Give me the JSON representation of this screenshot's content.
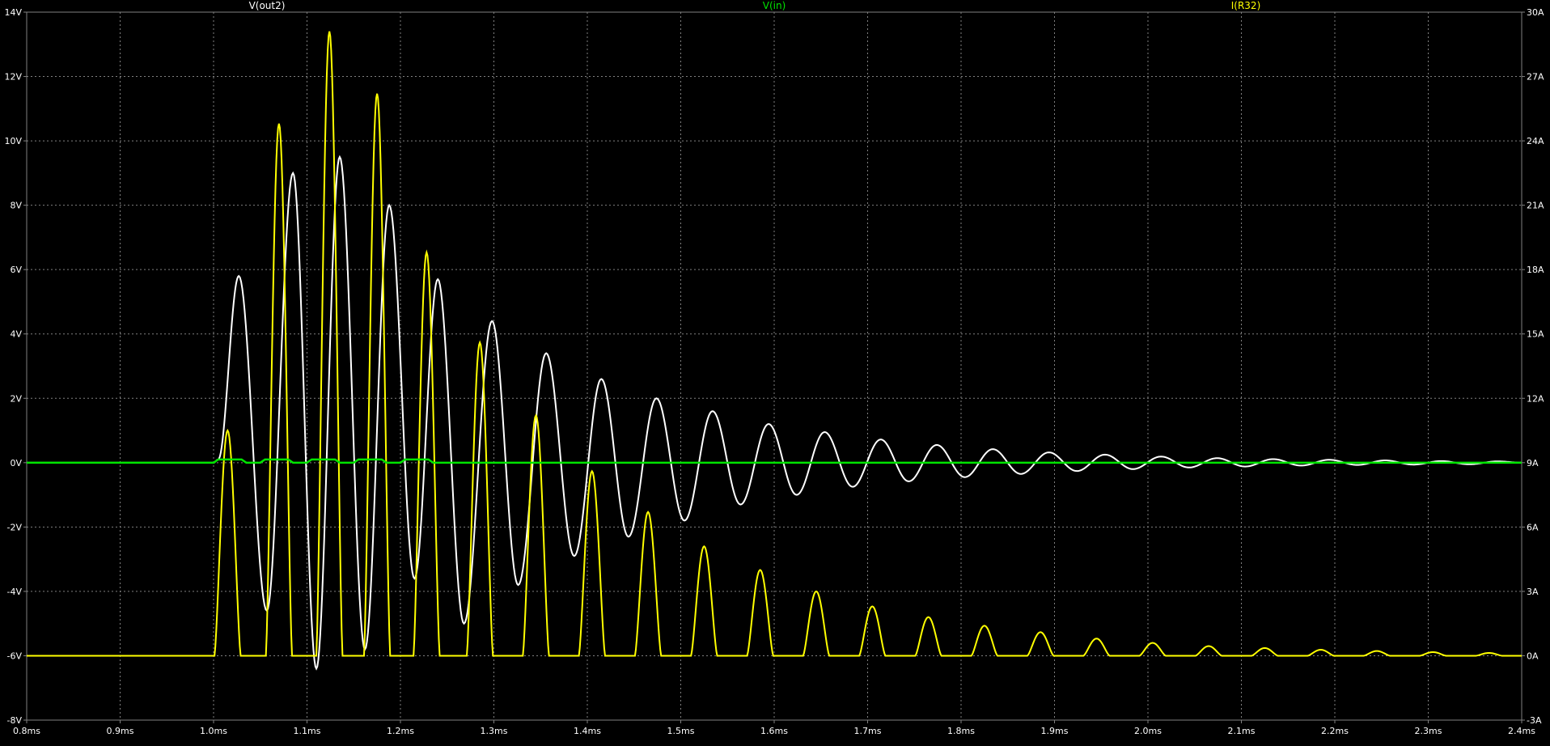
{
  "chart_data": {
    "type": "line",
    "title": "",
    "x_axis": {
      "range": [
        0.8,
        2.4
      ],
      "ticks": [
        0.8,
        0.9,
        1.0,
        1.1,
        1.2,
        1.3,
        1.4,
        1.5,
        1.6,
        1.7,
        1.8,
        1.9,
        2.0,
        2.1,
        2.2,
        2.3,
        2.4
      ],
      "tick_labels": [
        "0.8ms",
        "0.9ms",
        "1.0ms",
        "1.1ms",
        "1.2ms",
        "1.3ms",
        "1.4ms",
        "1.5ms",
        "1.6ms",
        "1.7ms",
        "1.8ms",
        "1.9ms",
        "2.0ms",
        "2.1ms",
        "2.2ms",
        "2.3ms",
        "2.4ms"
      ]
    },
    "y_left": {
      "range": [
        -8,
        14
      ],
      "ticks": [
        -8,
        -6,
        -4,
        -2,
        0,
        2,
        4,
        6,
        8,
        10,
        12,
        14
      ],
      "tick_labels": [
        "-8V",
        "-6V",
        "-4V",
        "-2V",
        "0V",
        "2V",
        "4V",
        "6V",
        "8V",
        "10V",
        "12V",
        "14V"
      ]
    },
    "y_right": {
      "range": [
        -3,
        30
      ],
      "ticks": [
        -3,
        0,
        3,
        6,
        9,
        12,
        15,
        18,
        21,
        24,
        27,
        30
      ],
      "tick_labels": [
        "-3A",
        "0A",
        "3A",
        "6A",
        "9A",
        "12A",
        "15A",
        "18A",
        "21A",
        "24A",
        "27A",
        "30A"
      ]
    },
    "grid": true,
    "legend": "top",
    "series": [
      {
        "name": "V(out2)",
        "axis": "left",
        "color": "#ffffff",
        "x": [
          0.8,
          1.0,
          1.005,
          1.027,
          1.057,
          1.085,
          1.11,
          1.135,
          1.162,
          1.188,
          1.215,
          1.24,
          1.268,
          1.298,
          1.326,
          1.356,
          1.386,
          1.415,
          1.444,
          1.474,
          1.504,
          1.534,
          1.564,
          1.594,
          1.624,
          1.654,
          1.684,
          1.714,
          1.744,
          1.774,
          1.804,
          1.834,
          1.864,
          1.894,
          1.924,
          1.954,
          1.984,
          2.014,
          2.044,
          2.074,
          2.104,
          2.134,
          2.164,
          2.194,
          2.224,
          2.254,
          2.284,
          2.314,
          2.344,
          2.374,
          2.4
        ],
        "y": [
          0,
          0,
          0.1,
          5.8,
          -4.6,
          9.0,
          -6.4,
          9.5,
          -5.8,
          8.0,
          -3.6,
          5.7,
          -5.0,
          4.4,
          -3.8,
          3.4,
          -2.9,
          2.6,
          -2.3,
          2.0,
          -1.8,
          1.6,
          -1.3,
          1.2,
          -1.0,
          0.95,
          -0.75,
          0.72,
          -0.58,
          0.55,
          -0.45,
          0.42,
          -0.35,
          0.32,
          -0.26,
          0.25,
          -0.2,
          0.19,
          -0.15,
          0.14,
          -0.12,
          0.11,
          -0.09,
          0.09,
          -0.07,
          0.07,
          -0.06,
          0.05,
          -0.05,
          0.04,
          0
        ]
      },
      {
        "name": "V(in)",
        "axis": "left",
        "color": "#00e400",
        "x": [
          0.8,
          1.0,
          1.005,
          1.03,
          1.035,
          1.05,
          1.055,
          1.08,
          1.085,
          1.1,
          1.105,
          1.13,
          1.135,
          1.15,
          1.155,
          1.18,
          1.185,
          1.2,
          1.205,
          1.23,
          1.235,
          2.4
        ],
        "y": [
          0,
          0,
          0.1,
          0.1,
          0,
          0,
          0.1,
          0.1,
          0,
          0,
          0.1,
          0.1,
          0,
          0,
          0.1,
          0.1,
          0,
          0,
          0.1,
          0.1,
          0,
          0
        ]
      },
      {
        "name": "I(R32)",
        "axis": "right",
        "color": "#ffff00",
        "pulses": [
          {
            "center": 1.015,
            "peak": 10.5
          },
          {
            "center": 1.07,
            "peak": 24.8
          },
          {
            "center": 1.124,
            "peak": 29.1
          },
          {
            "center": 1.175,
            "peak": 26.2
          },
          {
            "center": 1.228,
            "peak": 18.8
          },
          {
            "center": 1.285,
            "peak": 14.6
          },
          {
            "center": 1.345,
            "peak": 11.2
          },
          {
            "center": 1.405,
            "peak": 8.6
          },
          {
            "center": 1.465,
            "peak": 6.7
          },
          {
            "center": 1.525,
            "peak": 5.1
          },
          {
            "center": 1.585,
            "peak": 4.0
          },
          {
            "center": 1.645,
            "peak": 3.0
          },
          {
            "center": 1.705,
            "peak": 2.3
          },
          {
            "center": 1.765,
            "peak": 1.8
          },
          {
            "center": 1.825,
            "peak": 1.4
          },
          {
            "center": 1.885,
            "peak": 1.1
          },
          {
            "center": 1.945,
            "peak": 0.8
          },
          {
            "center": 2.005,
            "peak": 0.6
          },
          {
            "center": 2.065,
            "peak": 0.45
          },
          {
            "center": 2.125,
            "peak": 0.36
          },
          {
            "center": 2.185,
            "peak": 0.28
          },
          {
            "center": 2.245,
            "peak": 0.22
          },
          {
            "center": 2.305,
            "peak": 0.17
          },
          {
            "center": 2.365,
            "peak": 0.13
          }
        ],
        "baseline": 0
      }
    ]
  }
}
